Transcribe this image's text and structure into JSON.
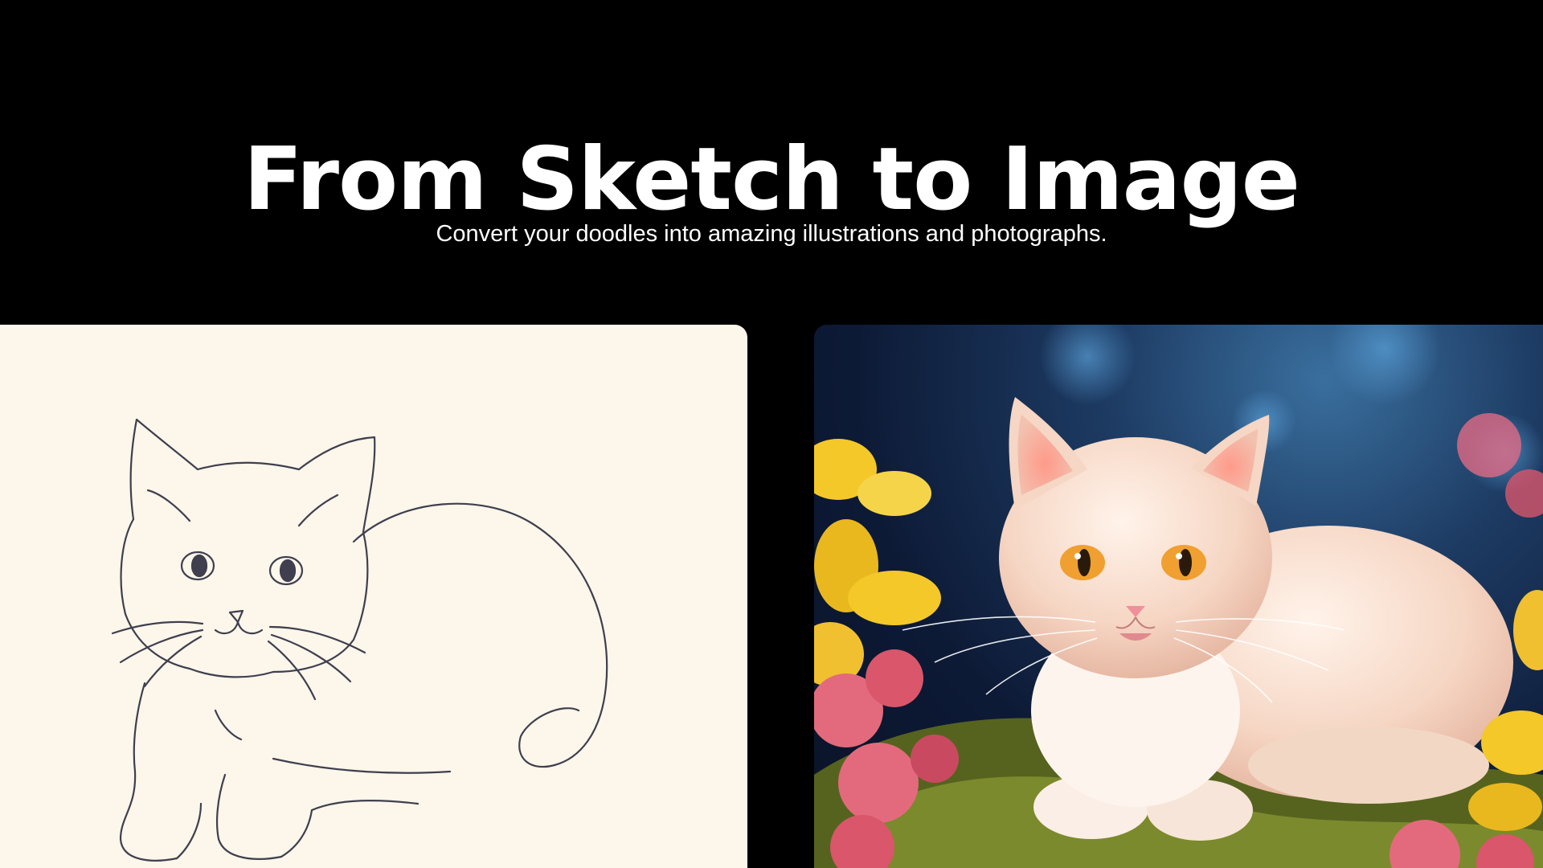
{
  "hero": {
    "title": "From Sketch to Image",
    "subtitle": "Convert your doodles into amazing illustrations and photographs."
  },
  "colors": {
    "background": "#000000",
    "text": "#ffffff",
    "sketch_paper": "#fdf6ea",
    "sketch_line": "#3f3f4f",
    "cat_fur": "#f6d6c4",
    "cat_eye": "#f0a030",
    "flower_yellow": "#f4c828",
    "flower_pink": "#e36a7c",
    "moss": "#7b8a2c"
  },
  "panels": {
    "sketch": {
      "subject": "cat line drawing"
    },
    "photo": {
      "subject": "rendered white cat on moss with flowers"
    }
  }
}
